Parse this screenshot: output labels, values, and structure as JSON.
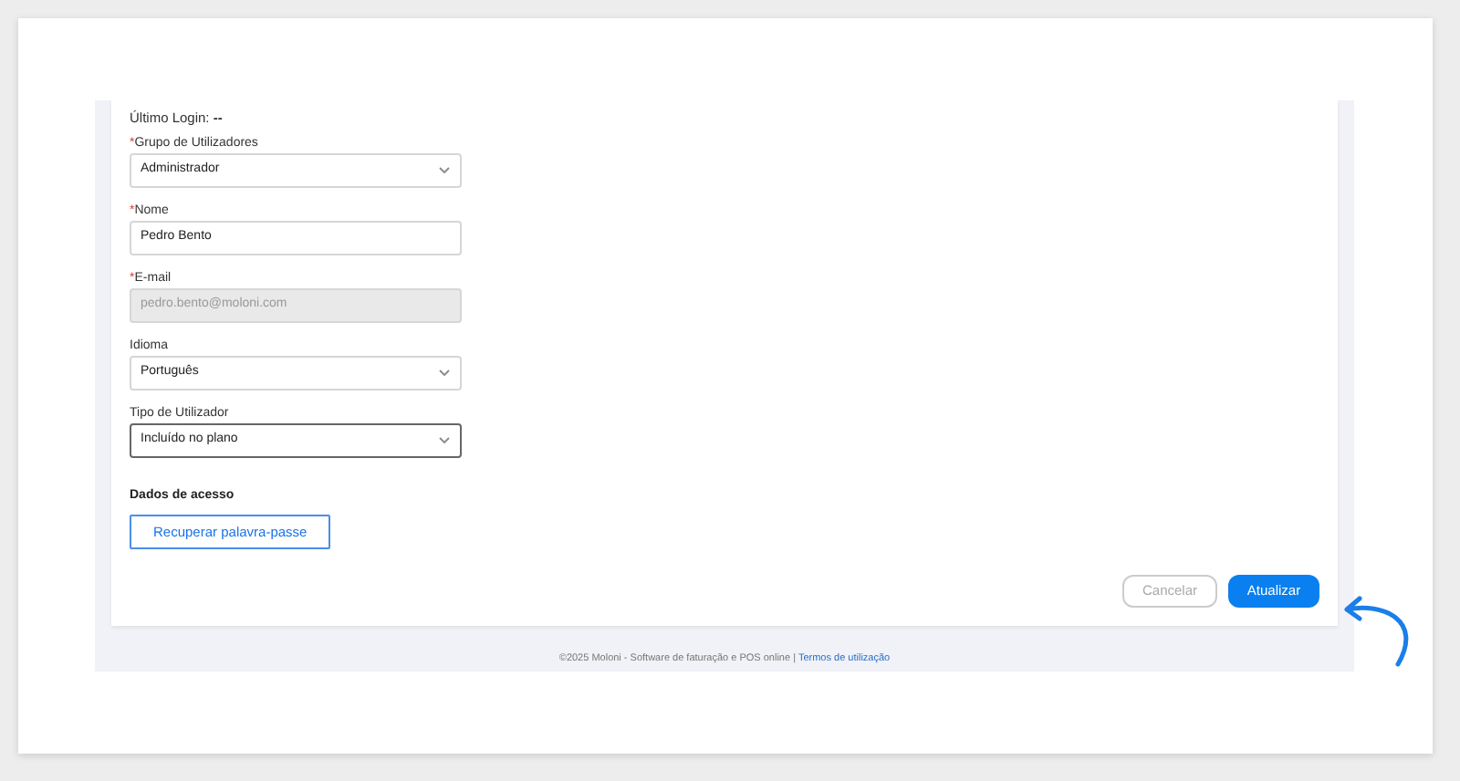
{
  "required_mark": "*",
  "last_login": {
    "label": "Último Login:",
    "value": "--"
  },
  "fields": [
    {
      "kind": "select",
      "label": "Grupo de Utilizadores",
      "required": true,
      "value": "Administrador",
      "disabled": false,
      "focused": false
    },
    {
      "kind": "input",
      "label": "Nome",
      "required": true,
      "value": "Pedro Bento",
      "disabled": false,
      "focused": false
    },
    {
      "kind": "input",
      "label": "E-mail",
      "required": true,
      "value": "pedro.bento@moloni.com",
      "disabled": true,
      "focused": false
    },
    {
      "kind": "select",
      "label": "Idioma",
      "required": false,
      "value": "Português",
      "disabled": false,
      "focused": false
    },
    {
      "kind": "select",
      "label": "Tipo de Utilizador",
      "required": false,
      "value": "Incluído no plano",
      "disabled": false,
      "focused": true
    }
  ],
  "access": {
    "title": "Dados de acesso",
    "button": "Recuperar palavra-passe"
  },
  "actions": {
    "cancel": "Cancelar",
    "submit": "Atualizar"
  },
  "footer": {
    "text": "©2025 Moloni - Software de faturação e POS online |",
    "link": "Termos de utilização"
  }
}
